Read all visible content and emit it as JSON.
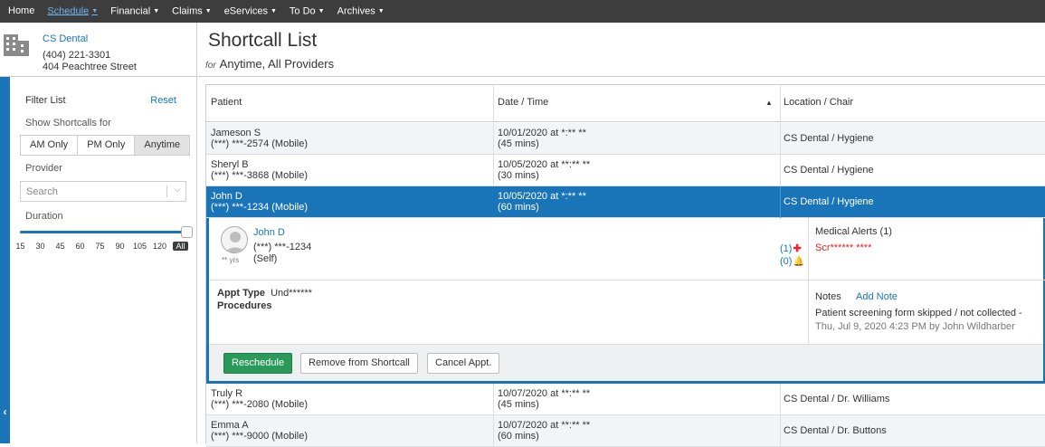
{
  "nav": {
    "items": [
      {
        "label": "Home",
        "caret": false,
        "active": false
      },
      {
        "label": "Schedule",
        "caret": true,
        "active": true
      },
      {
        "label": "Financial",
        "caret": true,
        "active": false
      },
      {
        "label": "Claims",
        "caret": true,
        "active": false
      },
      {
        "label": "eServices",
        "caret": true,
        "active": false
      },
      {
        "label": "To Do",
        "caret": true,
        "active": false
      },
      {
        "label": "Archives",
        "caret": true,
        "active": false
      }
    ]
  },
  "office": {
    "name": "CS Dental",
    "phone": "(404) 221-3301",
    "address": "404 Peachtree Street"
  },
  "filter": {
    "title": "Filter List",
    "reset": "Reset",
    "show_label": "Show Shortcalls for",
    "segments": [
      "AM Only",
      "PM Only",
      "Anytime"
    ],
    "selected_segment": "Anytime",
    "provider_label": "Provider",
    "provider_placeholder": "Search",
    "duration_label": "Duration",
    "duration_ticks": [
      "15",
      "30",
      "45",
      "60",
      "75",
      "90",
      "105",
      "120",
      "All"
    ],
    "duration_selected": "All"
  },
  "header": {
    "title": "Shortcall List",
    "for_label": "for",
    "subtitle": "Anytime, All Providers"
  },
  "table": {
    "columns": [
      "Patient",
      "Date / Time",
      "Location / Chair"
    ],
    "sorted_column": "Date / Time",
    "rows": [
      {
        "name": "Jameson S",
        "phone": "(***) ***-2574 (Mobile)",
        "date": "10/01/2020 at *:** **",
        "duration": "(45 mins)",
        "location": "CS Dental / Hygiene"
      },
      {
        "name": "Sheryl B",
        "phone": "(***) ***-3868 (Mobile)",
        "date": "10/05/2020 at **:** **",
        "duration": "(30 mins)",
        "location": "CS Dental / Hygiene"
      },
      {
        "name": "John D",
        "phone": "(***) ***-1234 (Mobile)",
        "date": "10/05/2020 at *:** **",
        "duration": "(60 mins)",
        "location": "CS Dental / Hygiene"
      },
      {
        "name": "Truly R",
        "phone": "(***) ***-2080 (Mobile)",
        "date": "10/07/2020 at **:** **",
        "duration": "(45 mins)",
        "location": "CS Dental / Dr. Williams"
      },
      {
        "name": "Emma A",
        "phone": "(***) ***-9000 (Mobile)",
        "date": "10/07/2020 at **:** **",
        "duration": "(60 mins)",
        "location": "CS Dental / Dr. Buttons"
      }
    ]
  },
  "detail": {
    "age": "** yrs",
    "name": "John D",
    "phone": "(***) ***-1234",
    "relation": "(Self)",
    "alert_count": "(1)",
    "notification_count": "(0)",
    "medical_alerts_title": "Medical Alerts (1)",
    "medical_alert": "Scr****** ****",
    "appt_type_label": "Appt Type",
    "appt_type_value": "Und******",
    "procedures_label": "Procedures",
    "notes_label": "Notes",
    "add_note": "Add Note",
    "note_text": "Patient screening form skipped / not collected -",
    "note_meta": "Thu, Jul 9, 2020 4:23 PM by John Wildharber",
    "buttons": {
      "reschedule": "Reschedule",
      "remove": "Remove from Shortcall",
      "cancel": "Cancel Appt."
    }
  },
  "colors": {
    "accent": "#1a74b8",
    "nav_bg": "#3d3d3d",
    "primary_button": "#2a9a5a",
    "alert_red": "#e02020"
  }
}
